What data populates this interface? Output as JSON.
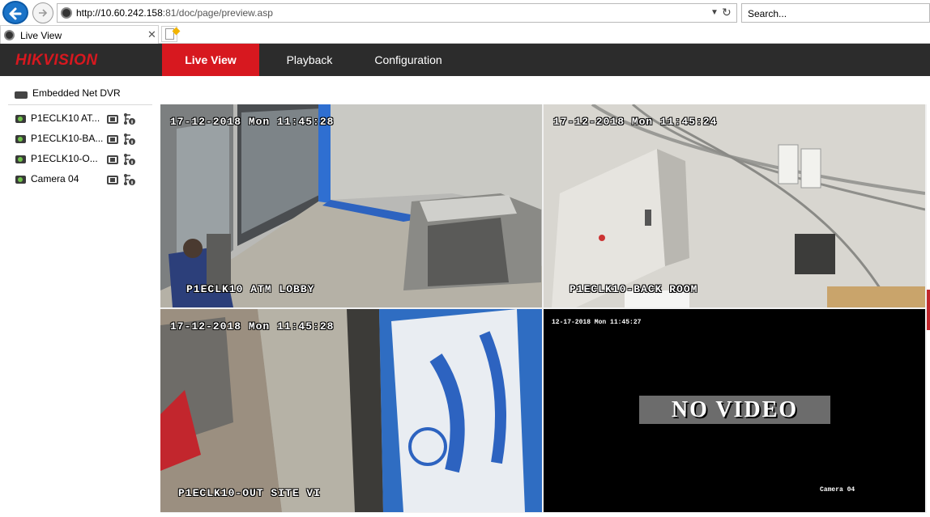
{
  "browser": {
    "url_host": "http://10.60.242.158",
    "url_path": ":81/doc/page/preview.asp",
    "search_placeholder": "Search...",
    "tab_title": "Live View",
    "tab_close": "✕"
  },
  "app": {
    "logo": "HIKVISION",
    "menu": [
      {
        "label": "Live View",
        "active": true
      },
      {
        "label": "Playback",
        "active": false
      },
      {
        "label": "Configuration",
        "active": false
      }
    ]
  },
  "sidebar": {
    "device": "Embedded Net DVR",
    "cameras": [
      {
        "label": "P1ECLK10 AT..."
      },
      {
        "label": "P1ECLK10-BA..."
      },
      {
        "label": "P1ECLK10-O..."
      },
      {
        "label": "Camera 04"
      }
    ]
  },
  "tiles": [
    {
      "timestamp": "17-12-2018 Mon 11:45:28",
      "name": "P1ECLK10 ATM LOBBY"
    },
    {
      "timestamp": "17-12-2018 Mon 11:45:24",
      "name": "P1ECLK10-BACK ROOM"
    },
    {
      "timestamp": "17-12-2018 Mon 11:45:28",
      "name": "P1ECLK10-OUT SITE VI"
    },
    {
      "timestamp": "12-17-2018 Mon 11:45:27",
      "name": "Camera 04",
      "status": "NO VIDEO"
    }
  ],
  "colors": {
    "brand_red": "#d7181f",
    "header_bg": "#2c2c2c",
    "selected_outline": "#e3b000"
  }
}
